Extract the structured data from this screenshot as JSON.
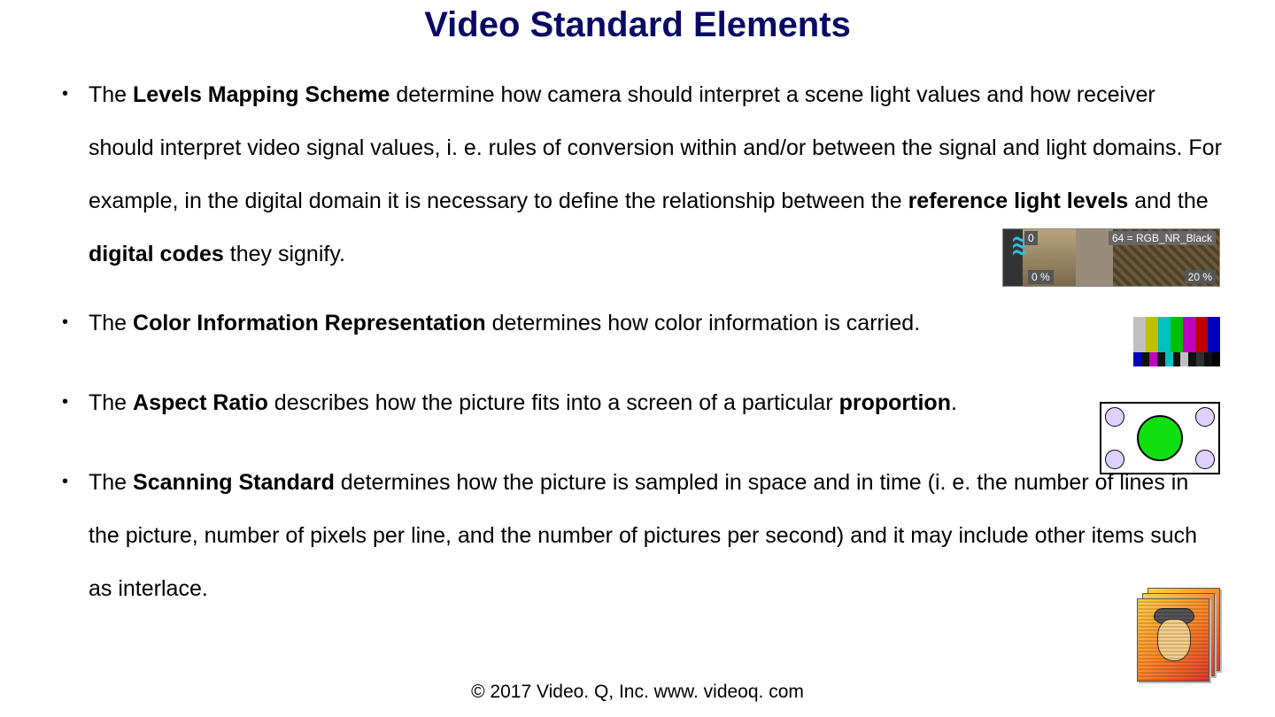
{
  "title": "Video Standard Elements",
  "bullets": {
    "b1": {
      "t1": "The ",
      "bold1": "Levels Mapping Scheme",
      "t2": " determine how camera should interpret a scene light values and how receiver should interpret video signal values, i. e. rules of conversion within and/or between the signal and light domains. For example, in the digital domain it is necessary to define the relationship between the ",
      "bold2": "reference light levels",
      "t3": " and the ",
      "bold3": "digital codes",
      "t4": " they signify."
    },
    "b2": {
      "t1": "The ",
      "bold1": "Color Information Representation",
      "t2": " determines how color information is carried."
    },
    "b3": {
      "t1": "The ",
      "bold1": "Aspect Ratio",
      "t2": " describes how the picture fits into a screen of a particular ",
      "bold2": "proportion",
      "t3": "."
    },
    "b4": {
      "t1": "The ",
      "bold1": "Scanning Standard",
      "t2": " determines how the picture is sampled in space and in time (i. e. the number of lines in the picture,  number of pixels per line, and the number of pictures per second) and it may include other items such as interlace."
    }
  },
  "levels_fig": {
    "zero": "0",
    "pct0": "0 %",
    "label64": "64 = RGB_NR_Black",
    "pct20": "20 %"
  },
  "colorbars": {
    "top": [
      "#c0c0c0",
      "#c0c000",
      "#00c0c0",
      "#00c000",
      "#c000c0",
      "#c00000",
      "#0000c0"
    ],
    "bottom": [
      "#0000c0",
      "#101010",
      "#c000c0",
      "#101010",
      "#00c0c0",
      "#101010",
      "#c0c0c0",
      "#101010",
      "#303030",
      "#101010",
      "#000000"
    ]
  },
  "footer": "© 2017 Video. Q, Inc. www. videoq. com"
}
